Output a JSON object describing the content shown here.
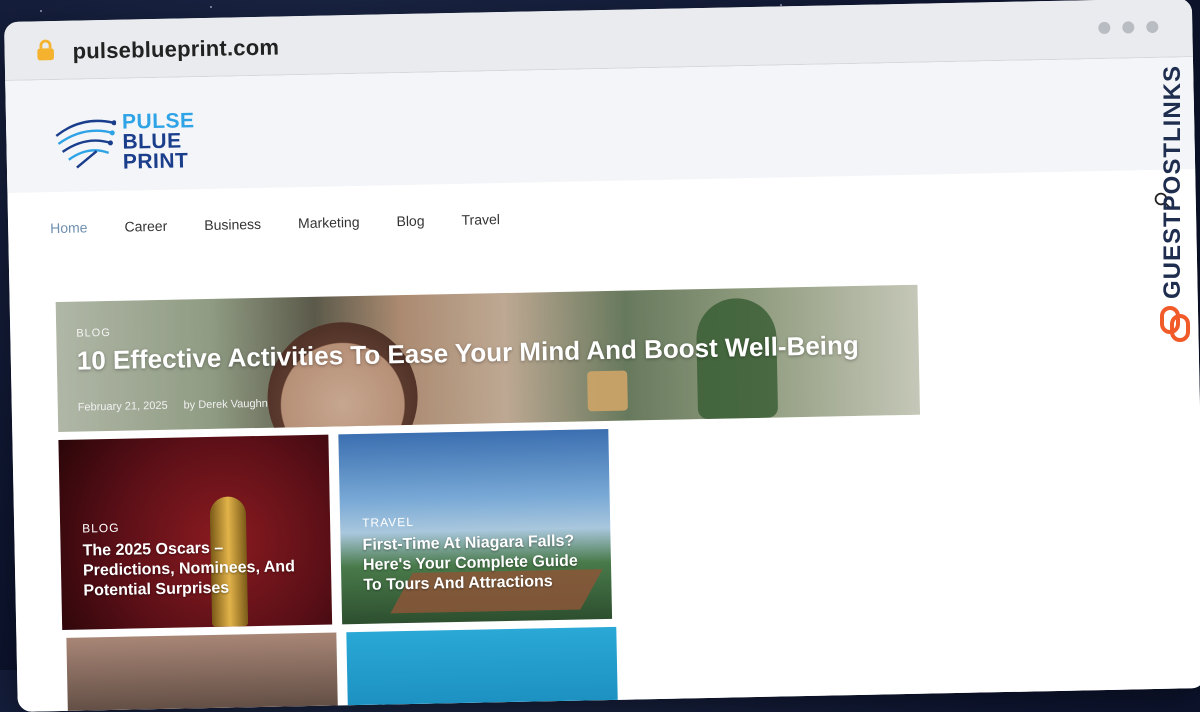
{
  "browser": {
    "url": "pulseblueprint.com",
    "lock_icon": "lock-icon",
    "window_dots": [
      "dot",
      "dot",
      "dot"
    ]
  },
  "site": {
    "logo": {
      "line1": "PULSE",
      "line2": "BLUE",
      "line3": "PRINT"
    },
    "nav": [
      {
        "label": "Home",
        "active": true
      },
      {
        "label": "Career"
      },
      {
        "label": "Business"
      },
      {
        "label": "Marketing"
      },
      {
        "label": "Blog"
      },
      {
        "label": "Travel"
      }
    ],
    "search_icon": "search-icon"
  },
  "hero": {
    "category": "BLOG",
    "title": "10 Effective Activities To Ease Your Mind And Boost Well-Being",
    "date": "February 21, 2025",
    "author": "by Derek Vaughn"
  },
  "cards": [
    {
      "category": "BLOG",
      "title": "The 2025 Oscars – Predictions, Nominees, And Potential Surprises"
    },
    {
      "category": "TRAVEL",
      "title": "First-Time At Niagara Falls? Here's Your Complete Guide To Tours And Attractions"
    }
  ],
  "badge": {
    "text": "GUESTPOSTLINKS"
  }
}
